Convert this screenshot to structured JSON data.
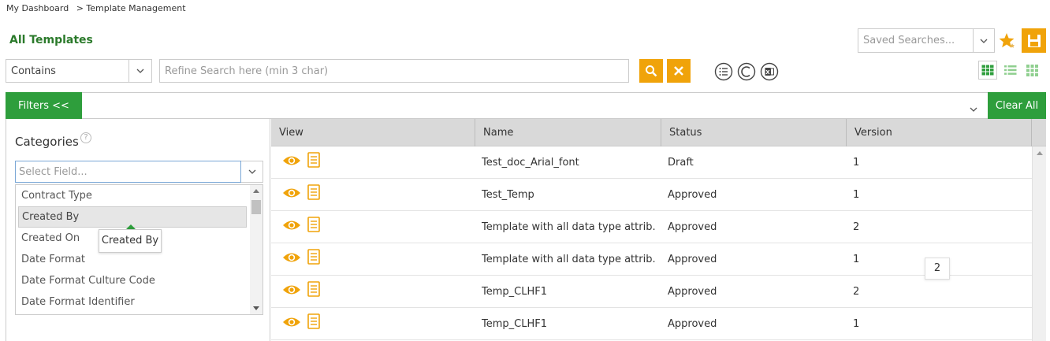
{
  "breadcrumb": {
    "home": "My Dashboard",
    "current": "> Template Management"
  },
  "page": {
    "title": "All Templates"
  },
  "saved_searches": {
    "placeholder": "Saved Searches..."
  },
  "search": {
    "operator": "Contains",
    "placeholder": "Refine Search here (min 3 char)"
  },
  "filters": {
    "toggle_label": "Filters <<",
    "clear_all_label": "Clear All"
  },
  "categories": {
    "title": "Categories",
    "help": "?",
    "select_placeholder": "Select Field...",
    "fields": [
      "Contract Type",
      "Created By",
      "Created On",
      "Date Format",
      "Date Format Culture Code",
      "Date Format Identifier"
    ],
    "hovered_index": 1,
    "tooltip": "Created By"
  },
  "grid": {
    "columns": [
      "View",
      "Name",
      "Status",
      "Version"
    ],
    "rows": [
      {
        "name": "Test_doc_Arial_font",
        "status": "Draft",
        "version": "1"
      },
      {
        "name": "Test_Temp",
        "status": "Approved",
        "version": "1"
      },
      {
        "name": "Template with all data type attrib...",
        "status": "Approved",
        "version": "2"
      },
      {
        "name": "Template with all data type attrib...",
        "status": "Approved",
        "version": "1"
      },
      {
        "name": "Temp_CLHF1",
        "status": "Approved",
        "version": "2"
      },
      {
        "name": "Temp_CLHF1",
        "status": "Approved",
        "version": "1"
      }
    ],
    "page_badge": "2"
  },
  "colors": {
    "accent": "#f0a30a",
    "green": "#2e9e3c",
    "title_green": "#2b7a2b"
  }
}
